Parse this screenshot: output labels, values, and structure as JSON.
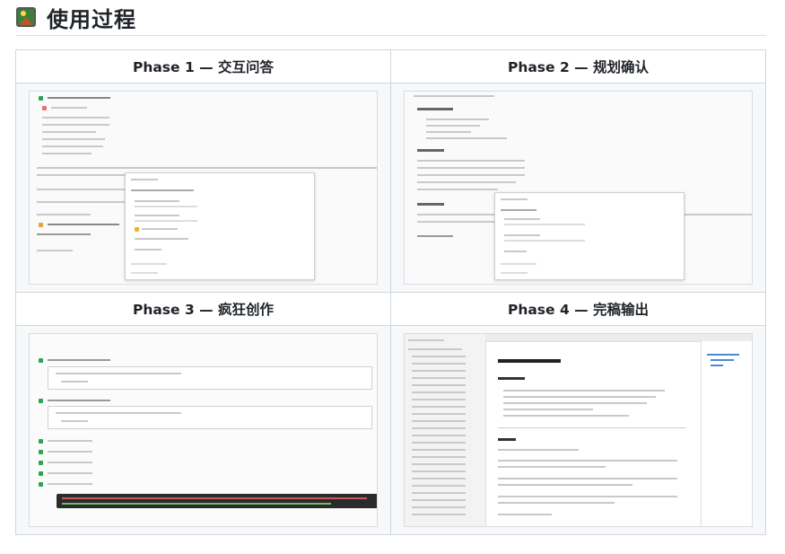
{
  "section": {
    "title": "使用过程"
  },
  "phases": [
    {
      "label": "Phase 1 — 交互问答"
    },
    {
      "label": "Phase 2 — 规划确认"
    },
    {
      "label": "Phase 3 — 疯狂创作"
    },
    {
      "label": "Phase 4 — 完稿输出"
    }
  ],
  "colors": {
    "accent_green": "#2da44e",
    "border": "#d0d7de"
  }
}
